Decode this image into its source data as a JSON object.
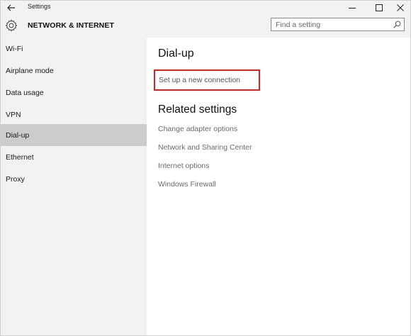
{
  "window": {
    "title": "Settings",
    "controls": {
      "minimize": "minimize-icon",
      "maximize": "maximize-icon",
      "close": "close-icon"
    }
  },
  "header": {
    "section_title": "NETWORK & INTERNET",
    "search_placeholder": "Find a setting"
  },
  "sidebar": {
    "items": [
      {
        "label": "Wi-Fi"
      },
      {
        "label": "Airplane mode"
      },
      {
        "label": "Data usage"
      },
      {
        "label": "VPN"
      },
      {
        "label": "Dial-up",
        "selected": true
      },
      {
        "label": "Ethernet"
      },
      {
        "label": "Proxy"
      }
    ]
  },
  "main": {
    "title": "Dial-up",
    "new_connection_label": "Set up a new connection",
    "related_heading": "Related settings",
    "related_links": [
      "Change adapter options",
      "Network and Sharing Center",
      "Internet options",
      "Windows Firewall"
    ]
  },
  "colors": {
    "selected_background": "#cccccc",
    "highlight_border": "#e0221f",
    "link_text": "#6b6b6b"
  }
}
